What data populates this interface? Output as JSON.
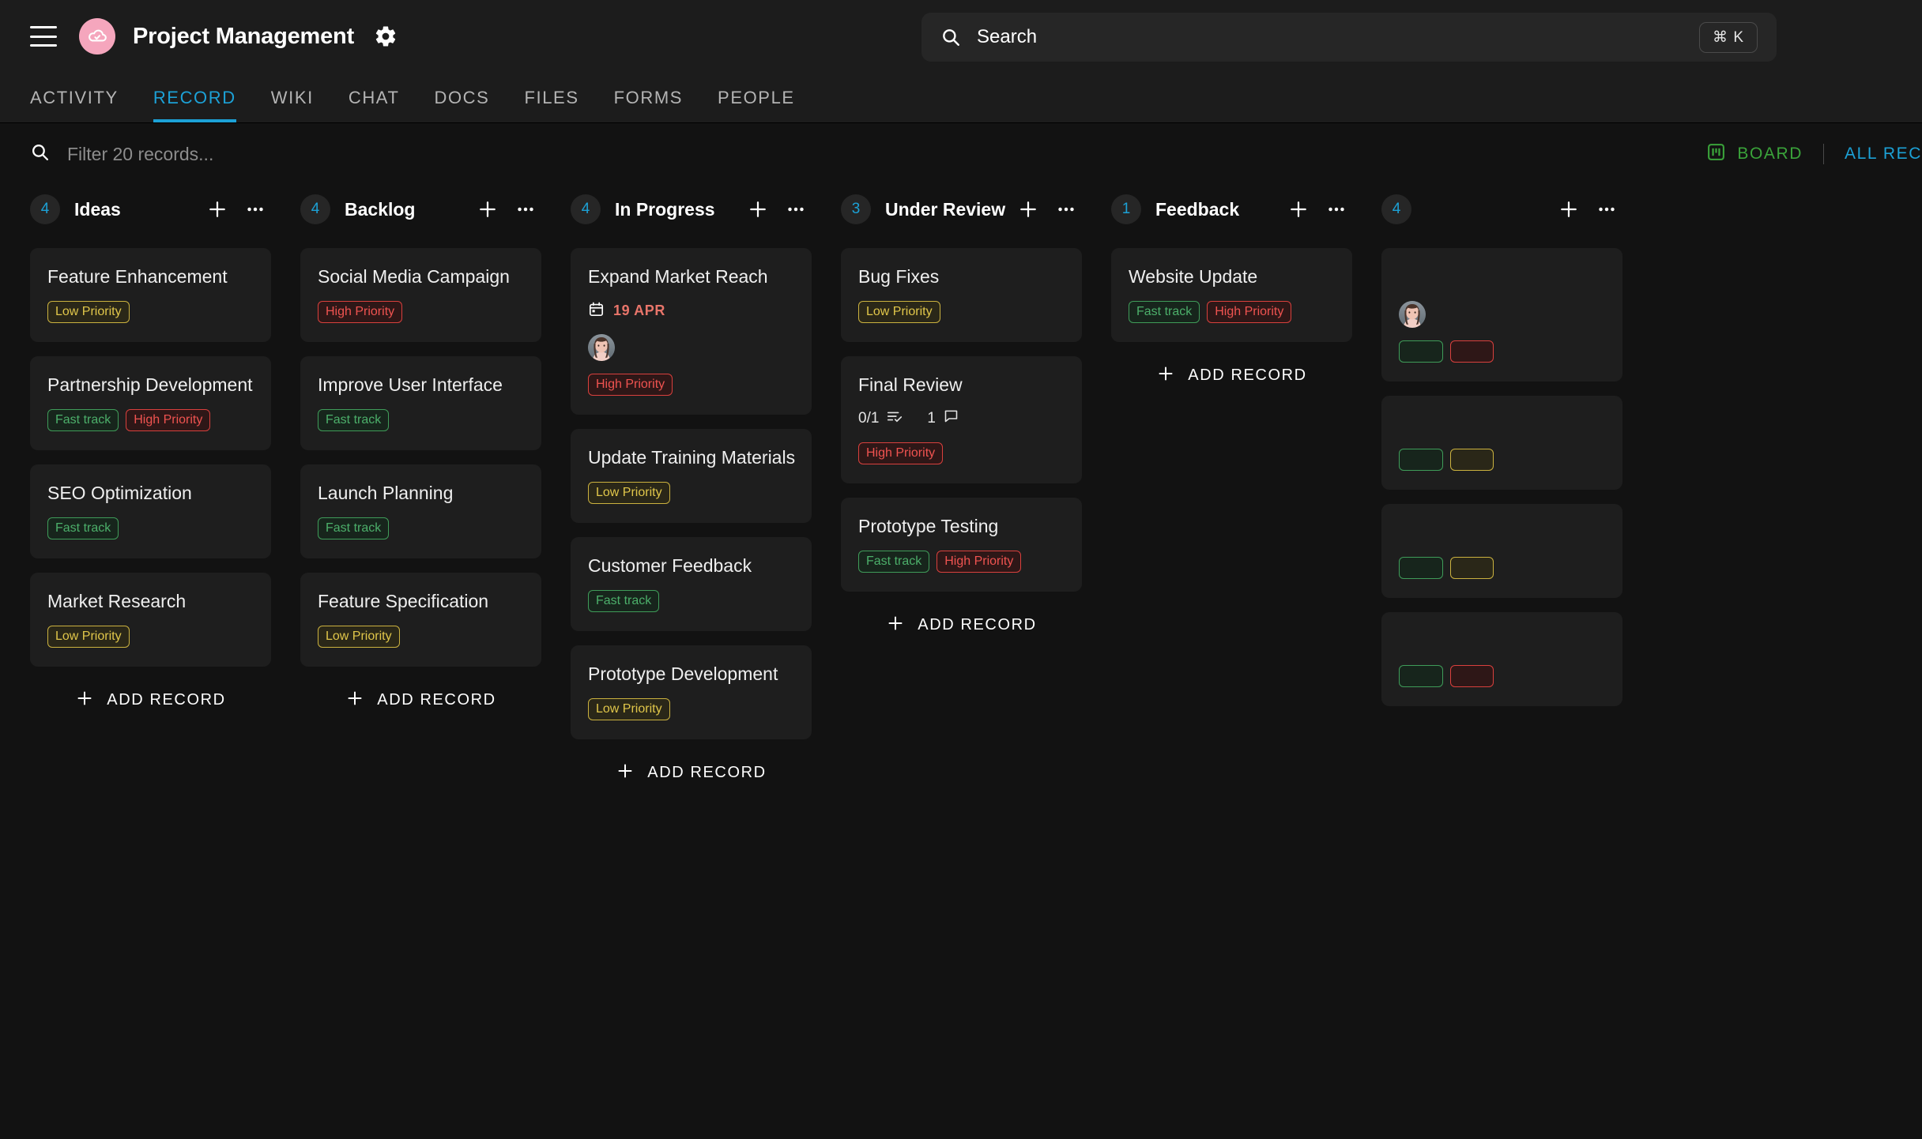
{
  "header": {
    "menu_icon": "hamburger-icon",
    "logo_icon": "cloud-check-logo",
    "title": "Project Management",
    "settings_icon": "gear-icon"
  },
  "search": {
    "icon": "search-icon",
    "value": "",
    "placeholder": "Search",
    "shortcut": "⌘ K"
  },
  "tabs": [
    {
      "label": "ACTIVITY",
      "active": false
    },
    {
      "label": "RECORD",
      "active": true
    },
    {
      "label": "WIKI",
      "active": false
    },
    {
      "label": "CHAT",
      "active": false
    },
    {
      "label": "DOCS",
      "active": false
    },
    {
      "label": "FILES",
      "active": false
    },
    {
      "label": "FORMS",
      "active": false
    },
    {
      "label": "PEOPLE",
      "active": false
    }
  ],
  "filter": {
    "icon": "search-icon",
    "value": "",
    "placeholder": "Filter 20 records..."
  },
  "view_controls": {
    "board_icon": "board-view-icon",
    "board_label": "BOARD",
    "all_records_label": "ALL REC"
  },
  "colors": {
    "accent_blue": "#1ca1d6",
    "board_green": "#3aa33a",
    "logo_pink": "#f5a6bd",
    "date_red": "#e8756a",
    "tag_low": "#e0c64a",
    "tag_high": "#ef5350",
    "tag_fast": "#4caf6a",
    "page_bg": "#121212",
    "card_bg": "#1e1e1e",
    "bar_bg": "#1c1c1c"
  },
  "add_record_label": "ADD RECORD",
  "columns": [
    {
      "name": "Ideas",
      "count": "4",
      "add_icon": "plus-icon",
      "more_icon": "ellipsis-icon",
      "cards": [
        {
          "title": "Feature Enhancement",
          "tags": [
            {
              "label": "Low Priority",
              "style": "low"
            }
          ]
        },
        {
          "title": "Partnership Development",
          "tags": [
            {
              "label": "Fast track",
              "style": "fast"
            },
            {
              "label": "High Priority",
              "style": "high"
            }
          ]
        },
        {
          "title": "SEO Optimization",
          "tags": [
            {
              "label": "Fast track",
              "style": "fast"
            }
          ]
        },
        {
          "title": "Market Research",
          "tags": [
            {
              "label": "Low Priority",
              "style": "low"
            }
          ]
        }
      ]
    },
    {
      "name": "Backlog",
      "count": "4",
      "add_icon": "plus-icon",
      "more_icon": "ellipsis-icon",
      "cards": [
        {
          "title": "Social Media Campaign",
          "tags": [
            {
              "label": "High Priority",
              "style": "high"
            }
          ]
        },
        {
          "title": "Improve User Interface",
          "tags": [
            {
              "label": "Fast track",
              "style": "fast"
            }
          ]
        },
        {
          "title": "Launch Planning",
          "tags": [
            {
              "label": "Fast track",
              "style": "fast"
            }
          ]
        },
        {
          "title": "Feature Specification",
          "tags": [
            {
              "label": "Low Priority",
              "style": "low"
            }
          ]
        }
      ]
    },
    {
      "name": "In Progress",
      "count": "4",
      "add_icon": "plus-icon",
      "more_icon": "ellipsis-icon",
      "cards": [
        {
          "title": "Expand Market Reach",
          "date": "19 APR",
          "date_icon": "calendar-icon",
          "avatars": 1,
          "tags": [
            {
              "label": "High Priority",
              "style": "high"
            }
          ]
        },
        {
          "title": "Update Training Materials",
          "tags": [
            {
              "label": "Low Priority",
              "style": "low"
            }
          ]
        },
        {
          "title": "Customer Feedback",
          "tags": [
            {
              "label": "Fast track",
              "style": "fast"
            }
          ]
        },
        {
          "title": "Prototype Development",
          "tags": [
            {
              "label": "Low Priority",
              "style": "low"
            }
          ]
        }
      ]
    },
    {
      "name": "Under Review",
      "count": "3",
      "add_icon": "plus-icon",
      "more_icon": "ellipsis-icon",
      "cards": [
        {
          "title": "Bug Fixes",
          "tags": [
            {
              "label": "Low Priority",
              "style": "low"
            }
          ]
        },
        {
          "title": "Final Review",
          "checklist": "0/1",
          "checklist_icon": "checklist-icon",
          "comments": "1",
          "comments_icon": "comment-icon",
          "tags": [
            {
              "label": "High Priority",
              "style": "high"
            }
          ]
        },
        {
          "title": "Prototype Testing",
          "tags": [
            {
              "label": "Fast track",
              "style": "fast"
            },
            {
              "label": "High Priority",
              "style": "high"
            }
          ]
        }
      ]
    },
    {
      "name": "Feedback",
      "count": "1",
      "add_icon": "plus-icon",
      "more_icon": "ellipsis-icon",
      "cards": [
        {
          "title": "Website Update",
          "tags": [
            {
              "label": "Fast track",
              "style": "fast"
            },
            {
              "label": "High Priority",
              "style": "high"
            }
          ]
        }
      ]
    },
    {
      "name": "",
      "count": "4",
      "add_icon": "plus-icon",
      "more_icon": "ellipsis-icon",
      "cards": [
        {
          "title": "",
          "avatars": 1,
          "tags": [
            {
              "label": "",
              "style": "fast"
            },
            {
              "label": "",
              "style": "high"
            }
          ]
        },
        {
          "title": "",
          "tags": [
            {
              "label": "",
              "style": "fast"
            },
            {
              "label": "",
              "style": "low"
            }
          ]
        },
        {
          "title": "",
          "tags": [
            {
              "label": "",
              "style": "fast"
            },
            {
              "label": "",
              "style": "low"
            }
          ]
        },
        {
          "title": "",
          "tags": [
            {
              "label": "",
              "style": "fast"
            },
            {
              "label": "",
              "style": "high"
            }
          ]
        }
      ]
    }
  ]
}
